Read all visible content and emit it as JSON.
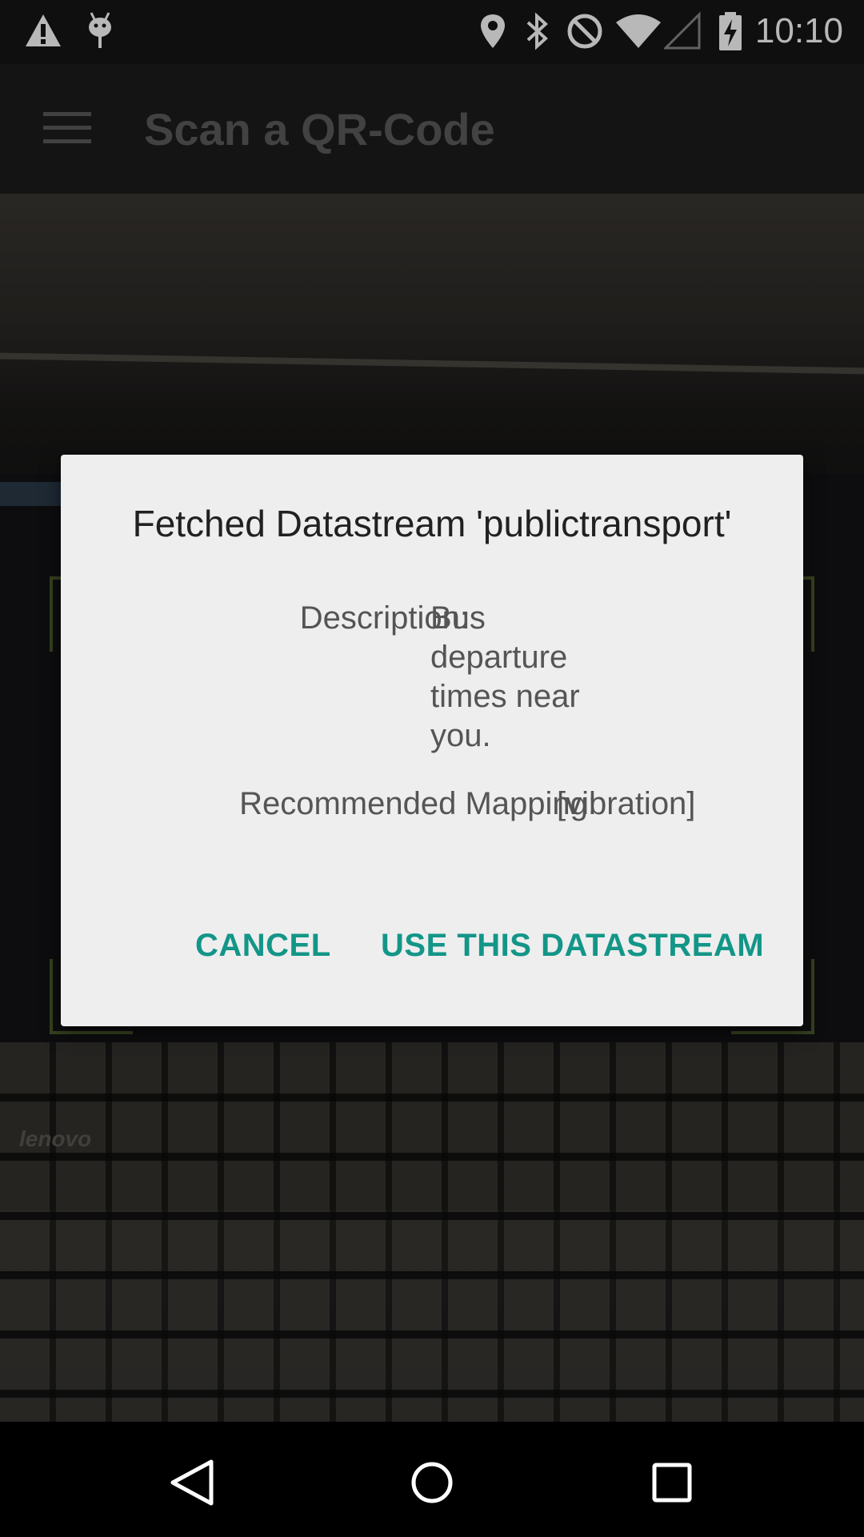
{
  "status_bar": {
    "time": "10:10",
    "left_icons": [
      "warning-icon",
      "android-debug-icon"
    ],
    "right_icons": [
      "location-icon",
      "bluetooth-icon",
      "do-not-disturb-icon",
      "wifi-icon",
      "signal-icon",
      "battery-charging-icon"
    ]
  },
  "toolbar": {
    "title": "Scan a QR-Code",
    "menu_icon": "hamburger-menu-icon"
  },
  "camera": {
    "brand": "lenovo"
  },
  "dialog": {
    "title": "Fetched Datastream 'publictransport'",
    "description_label": "Description:",
    "description_value": "Bus departure times near you.",
    "mapping_label": "Recommended Mapping:",
    "mapping_value": "[vibration]",
    "cancel_label": "CANCEL",
    "use_label": "USE THIS DATASTREAM",
    "accent_color": "#139688"
  },
  "nav_bar": {
    "icons": [
      "back-icon",
      "home-icon",
      "recent-apps-icon"
    ]
  }
}
